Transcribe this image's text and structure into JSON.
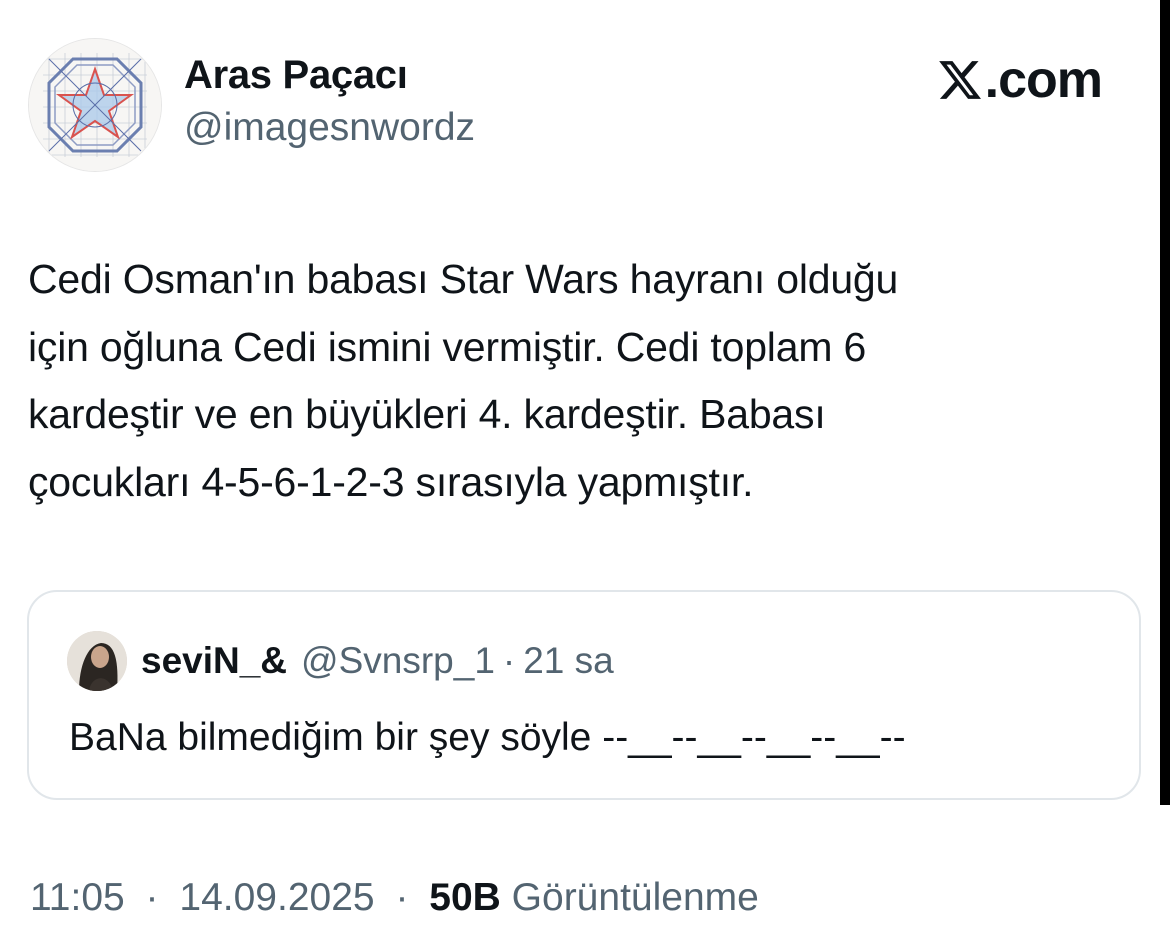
{
  "author": {
    "display_name": "Aras Paçacı",
    "handle": "@imagesnwordz",
    "avatar_icon": "star-diagram-avatar"
  },
  "brand": {
    "logo_icon": "x-logo-icon",
    "text": ".com"
  },
  "tweet": {
    "text": "Cedi Osman'ın babası Star Wars hayranı olduğu\niçin oğluna Cedi ismini vermiştir. Cedi toplam 6\nkardeştir ve en büyükleri 4. kardeştir. Babası\nçocukları 4-5-6-1-2-3 sırasıyla yapmıştır."
  },
  "quoted_tweet": {
    "display_name": "seviN_&",
    "handle": "@Svnsrp_1",
    "separator": "·",
    "time": "21 sa",
    "text": "BaNa bilmediğim bir şey söyle --__--__--__--__--",
    "avatar_icon": "profile-photo-avatar"
  },
  "meta": {
    "time": "11:05",
    "separator": "·",
    "date": "14.09.2025",
    "views_count": "50B",
    "views_label": "Görüntülenme"
  },
  "colors": {
    "text_primary": "#0f1419",
    "text_secondary": "#536471",
    "border": "#e1e6ea",
    "background": "#ffffff"
  }
}
